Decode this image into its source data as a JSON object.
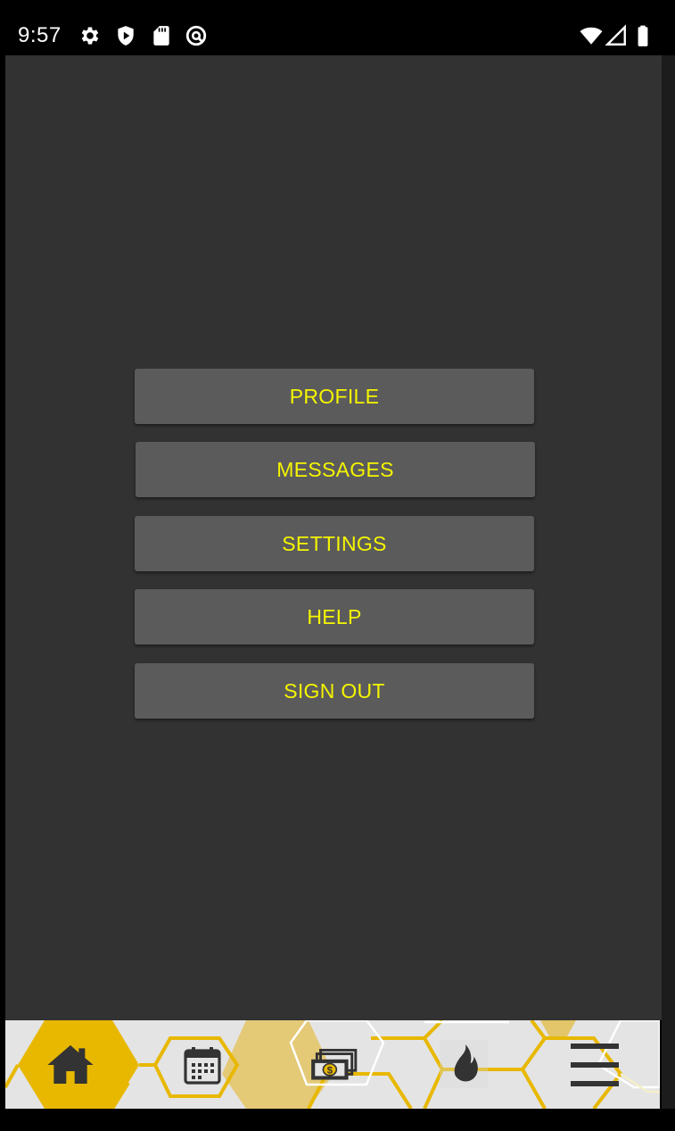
{
  "status_bar": {
    "time": "9:57",
    "left_icons": [
      "gear-icon",
      "shield-icon",
      "sd-card-icon",
      "vpn-icon"
    ],
    "right_icons": [
      "wifi-icon",
      "signal-icon",
      "battery-icon"
    ]
  },
  "menu": {
    "items": [
      {
        "label": "PROFILE"
      },
      {
        "label": "MESSAGES"
      },
      {
        "label": "SETTINGS"
      },
      {
        "label": "HELP"
      },
      {
        "label": "SIGN OUT"
      }
    ]
  },
  "bottom_nav": {
    "items": [
      {
        "icon": "home-icon",
        "active": true
      },
      {
        "icon": "calendar-icon",
        "active": false
      },
      {
        "icon": "money-icon",
        "active": false
      },
      {
        "icon": "flame-icon",
        "active": false
      },
      {
        "icon": "hamburger-menu-icon",
        "active": false
      }
    ]
  },
  "colors": {
    "background": "#323232",
    "button": "#5b5b5c",
    "button_text": "#f5f500",
    "accent": "#e8b800",
    "nav_background": "#e4e4e4",
    "icon_dark": "#333333"
  }
}
